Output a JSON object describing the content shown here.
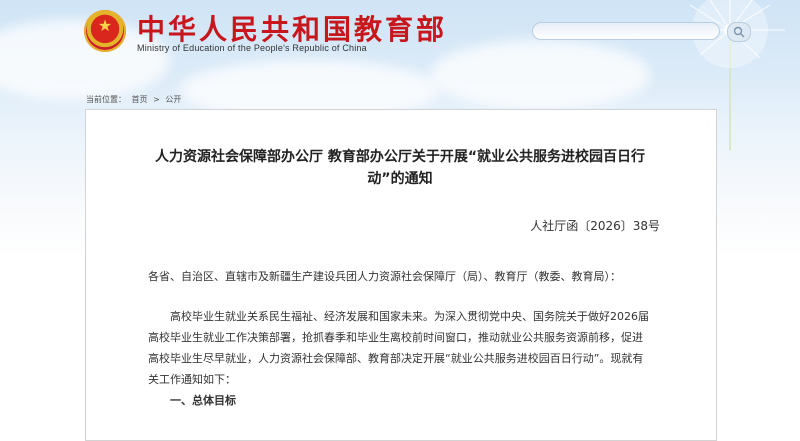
{
  "header": {
    "site_title": "中华人民共和国教育部",
    "site_subtitle": "Ministry of Education of the People's Republic of China",
    "search_placeholder": ""
  },
  "breadcrumb": {
    "prefix": "当前位置：",
    "items": [
      "首页",
      ">",
      "公开"
    ]
  },
  "document": {
    "title": "人力资源社会保障部办公厅 教育部办公厅关于开展“就业公共服务进校园百日行动”的通知",
    "number": "人社厅函〔2026〕38号",
    "salutation": "各省、自治区、直辖市及新疆生产建设兵团人力资源社会保障厅（局）、教育厅（教委、教育局）：",
    "body": "高校毕业生就业关系民生福祉、经济发展和国家未来。为深入贯彻党中央、国务院关于做好2026届高校毕业生就业工作决策部署，抢抓春季和毕业生离校前时间窗口，推动就业公共服务资源前移，促进高校毕业生尽早就业，人力资源社会保障部、教育部决定开展“就业公共服务进校园百日行动”。现就有关工作通知如下：",
    "section_1": "一、总体目标"
  },
  "colors": {
    "brand_red": "#c8161d",
    "panel_border": "#d3d3d3"
  }
}
